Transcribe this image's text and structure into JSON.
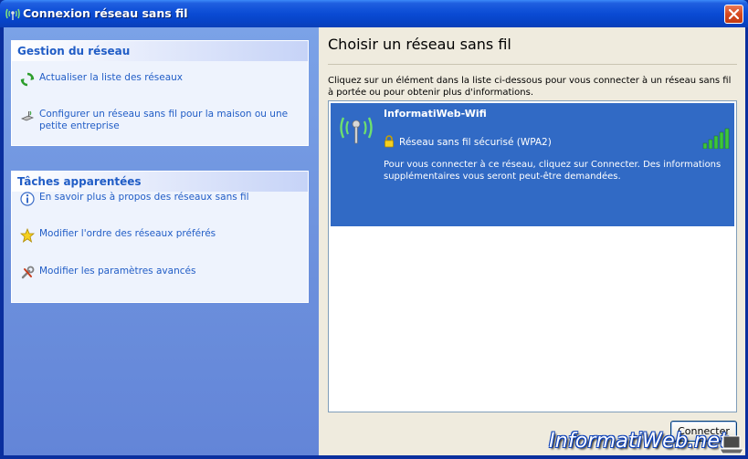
{
  "window": {
    "title": "Connexion réseau sans fil",
    "title_icon": "wireless-network-icon"
  },
  "left_pane": {
    "network_tasks": {
      "header": "Gestion du réseau",
      "items": [
        {
          "label": "Actualiser la liste des réseaux",
          "icon": "refresh-icon"
        },
        {
          "label": "Configurer un réseau sans fil pour la maison ou une petite entreprise",
          "icon": "setup-network-icon"
        }
      ]
    },
    "related_tasks": {
      "header": "Tâches apparentées",
      "items": [
        {
          "label": "En savoir plus à propos des réseaux sans fil",
          "icon": "info-icon"
        },
        {
          "label": "Modifier l'ordre des réseaux préférés",
          "icon": "star-icon"
        },
        {
          "label": "Modifier les paramètres avancés",
          "icon": "tools-icon"
        }
      ]
    }
  },
  "right_pane": {
    "title": "Choisir un réseau sans fil",
    "description": "Cliquez sur un élément dans la liste ci-dessous pour vous connecter à un réseau sans fil à portée ou pour obtenir plus d'informations.",
    "networks": [
      {
        "name": "InformatiWeb-Wifi",
        "security": "Réseau sans fil sécurisé (WPA2)",
        "info": "Pour vous connecter à ce réseau, cliquez sur Connecter. Des informations supplémentaires vous seront peut-être demandées.",
        "signal_bars": 5,
        "selected": true
      }
    ],
    "connect_button": "Connecter"
  },
  "watermark": {
    "text": "InformatiWeb.net"
  },
  "colors": {
    "title_bar": "#0a4bd4",
    "task_header_text": "#215dc6",
    "selection": "#316ac5",
    "signal_green": "#3cc63c"
  }
}
